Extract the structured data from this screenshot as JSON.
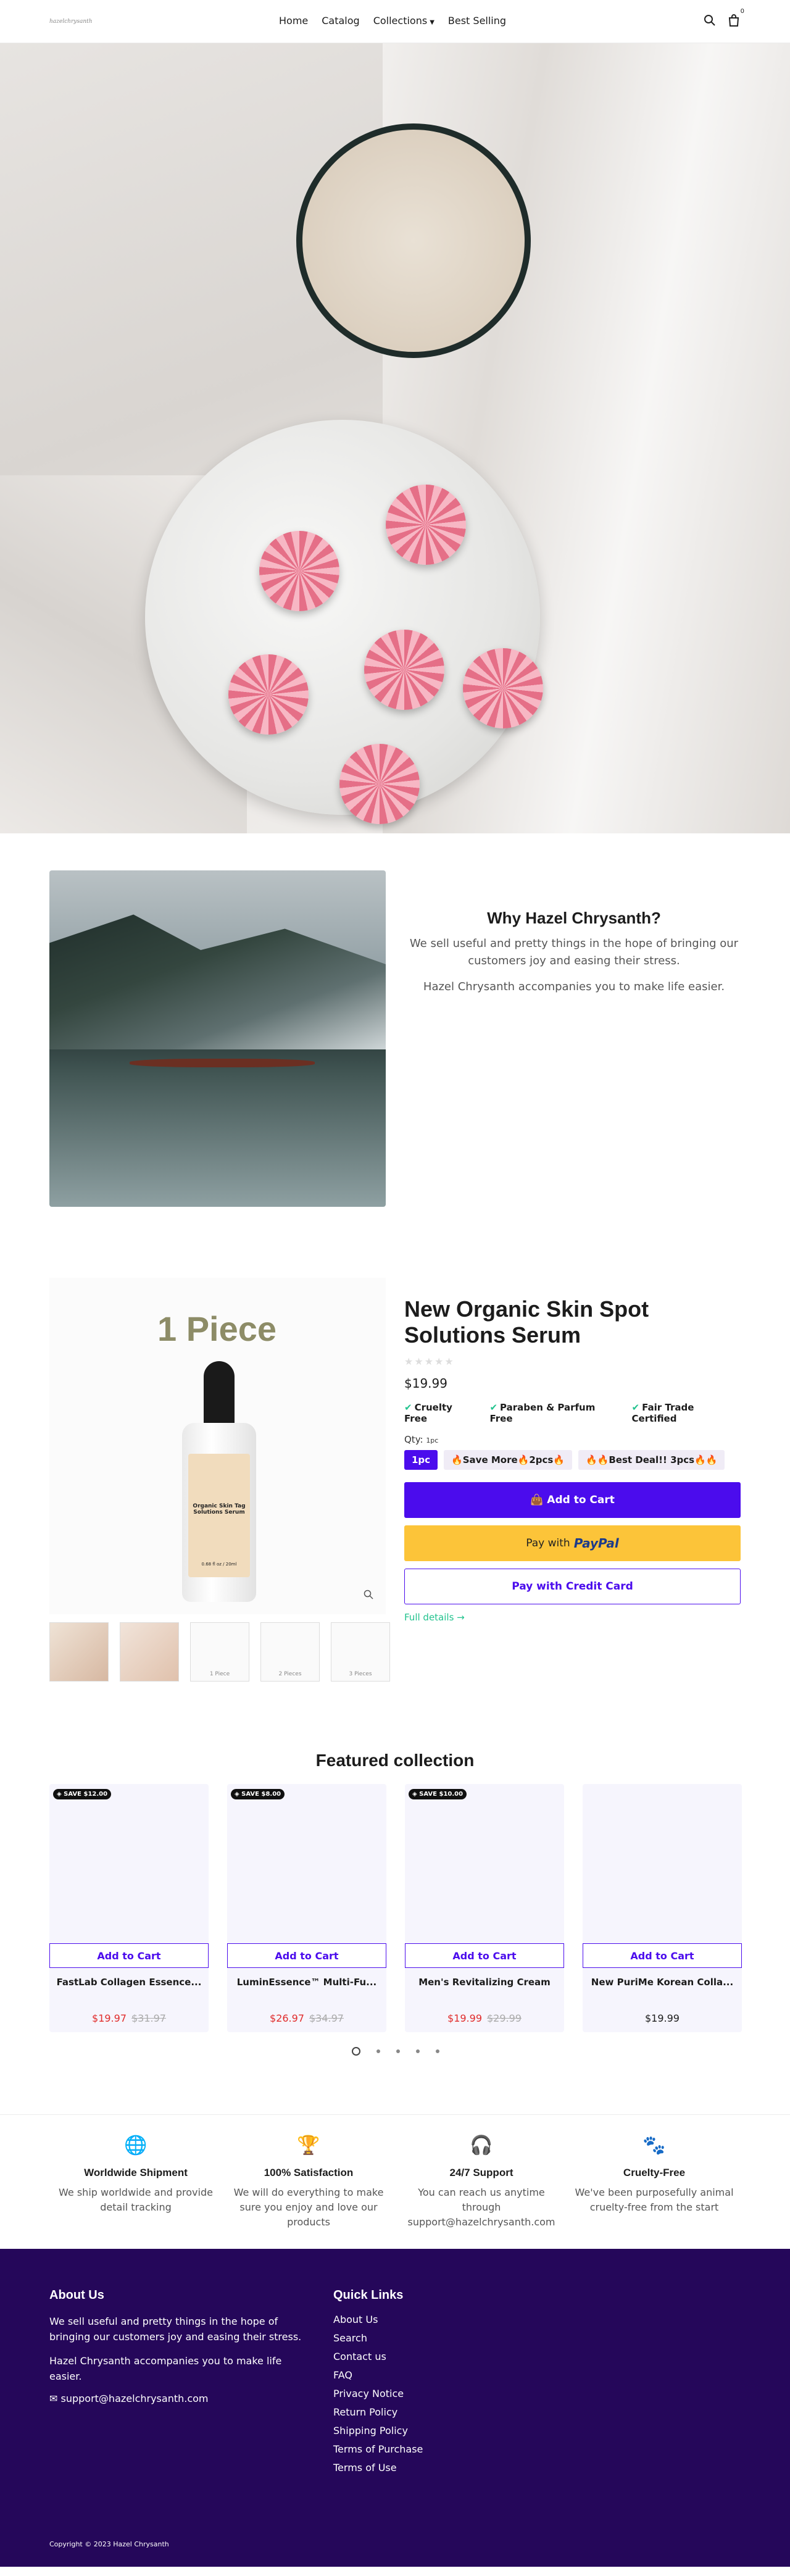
{
  "header": {
    "logo_text": "hazelchrysanth",
    "nav": [
      "Home",
      "Catalog",
      "Collections",
      "Best Selling"
    ],
    "cart_count": "0",
    "icons": [
      "search-icon",
      "cart-icon",
      "chevron-down-icon"
    ]
  },
  "why": {
    "title": "Why Hazel Chrysanth?",
    "p1": "We sell useful and pretty things in the hope of bringing our customers joy and easing their stress.",
    "p2": "Hazel Chrysanth accompanies you to make life easier."
  },
  "product": {
    "image_heading": "1 Piece",
    "bottle_label": "Organic Skin Tag Solutions Serum",
    "bottle_size": "0.68 fl oz / 20ml",
    "title": "New Organic Skin Spot Solutions Serum",
    "price": "$19.99",
    "badges": [
      "Cruelty Free",
      "Paraben & Parfum Free",
      "Fair Trade Certified"
    ],
    "qty_label": "Qty:",
    "qty_value": "1pc",
    "qty_options": [
      "1pc",
      "🔥Save More🔥2pcs🔥",
      "🔥🔥Best Deal!! 3pcs🔥🔥"
    ],
    "add_to_cart": "Add to Cart",
    "paypal_prefix": "Pay with",
    "paypal_brand": "PayPal",
    "credit_card": "Pay with Credit Card",
    "full_details": "Full details →",
    "thumbs": [
      "",
      "",
      "1 Piece",
      "2 Pieces",
      "3 Pieces"
    ]
  },
  "featured": {
    "title": "Featured collection",
    "add_label": "Add to Cart",
    "cards": [
      {
        "badge": "SAVE $12.00",
        "title": "FastLab Collagen Essence...",
        "sale": "$19.97",
        "old": "$31.97"
      },
      {
        "badge": "SAVE $8.00",
        "title": "LuminEssence™ Multi-Fu...",
        "sale": "$26.97",
        "old": "$34.97"
      },
      {
        "badge": "SAVE $10.00",
        "title": "Men's Revitalizing Cream",
        "sale": "$19.99",
        "old": "$29.99"
      },
      {
        "badge": "",
        "title": "New PuriMe Korean Colla...",
        "sale": "",
        "old": "",
        "price": "$19.99"
      }
    ]
  },
  "features": [
    {
      "icon": "globe-icon",
      "title": "Worldwide Shipment",
      "text": "We ship worldwide and provide detail tracking"
    },
    {
      "icon": "trophy-icon",
      "title": "100% Satisfaction",
      "text": "We will do everything to make sure you enjoy and love our products"
    },
    {
      "icon": "headset-icon",
      "title": "24/7 Support",
      "text": "You can reach us anytime through support@hazelchrysanth.com"
    },
    {
      "icon": "paw-icon",
      "title": "Cruelty-Free",
      "text": "We've been purposefully animal cruelty-free from the start"
    }
  ],
  "footer": {
    "about_title": "About Us",
    "about_p1": "We sell useful and pretty things in the hope of bringing our customers joy and easing their stress.",
    "about_p2": "Hazel Chrysanth accompanies you to make life easier.",
    "email": "support@hazelchrysanth.com",
    "links_title": "Quick Links",
    "links": [
      "About Us",
      "Search",
      "Contact us",
      "FAQ",
      "Privacy Notice",
      "Return Policy",
      "Shipping Policy",
      "Terms of Purchase",
      "Terms of Use"
    ],
    "copyright": "Copyright © 2023 Hazel Chrysanth"
  },
  "colors": {
    "accent": "#4b0ced",
    "green": "#22c38e",
    "footer_bg": "#25075a",
    "sale_red": "#e02b2b",
    "paypal_yellow": "#fcc439"
  }
}
